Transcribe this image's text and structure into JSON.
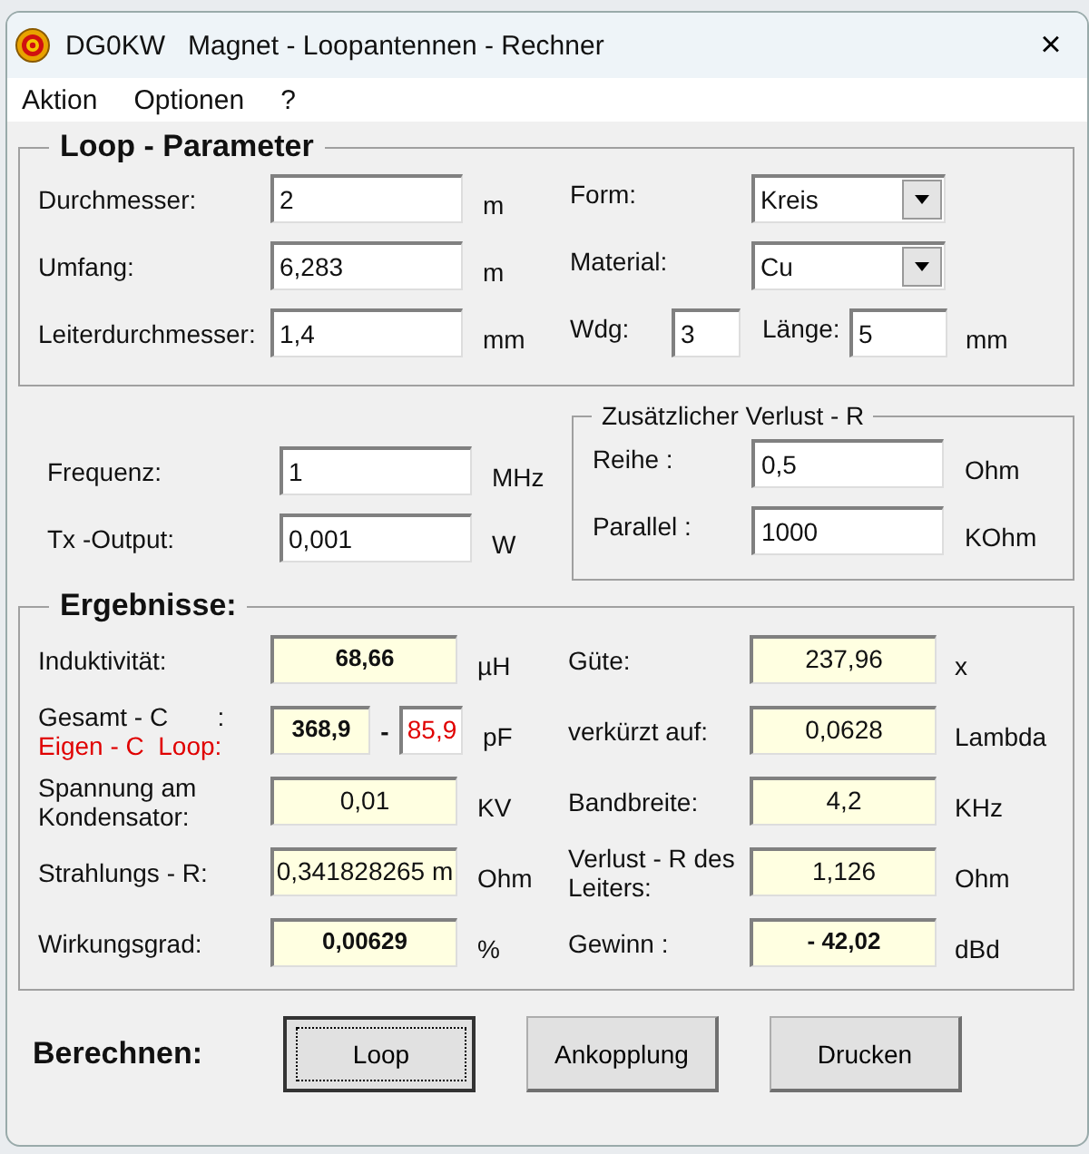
{
  "window": {
    "title": "DG0KW   Magnet - Loopantennen - Rechner",
    "close": "×"
  },
  "menu": [
    {
      "label": "Aktion"
    },
    {
      "label": "Optionen"
    },
    {
      "label": "?"
    }
  ],
  "loop_parameter": {
    "title": "Loop - Parameter",
    "rows": [
      {
        "label": "Durchmesser:",
        "value": "2",
        "unit": "m",
        "right": {
          "kind": "select",
          "label": "Form:",
          "value": "Kreis"
        }
      },
      {
        "label": "Umfang:",
        "value": "6,283",
        "unit": "m",
        "right": {
          "kind": "select",
          "label": "Material:",
          "value": "Cu"
        }
      },
      {
        "label": "Leiterdurchmesser:",
        "value": "1,4",
        "unit": "mm",
        "right": {
          "kind": "pair",
          "label": "Wdg:",
          "value": "3",
          "label_2": "Länge:",
          "value_2": "5",
          "unit": "mm"
        }
      }
    ]
  },
  "signal": [
    {
      "label": "Frequenz:",
      "value": "1",
      "unit": "MHz"
    },
    {
      "label": "Tx -Output:",
      "value": "0,001",
      "unit": "W"
    }
  ],
  "extra_loss": {
    "title": "Zusätzlicher Verlust - R",
    "rows": [
      {
        "label": "Reihe :",
        "value": "0,5",
        "unit": "Ohm"
      },
      {
        "label": "Parallel :",
        "value": "1000",
        "unit": "KOhm"
      }
    ]
  },
  "results": {
    "title": "Ergebnisse:",
    "left": [
      {
        "kind": "single",
        "label": "Induktivität:",
        "value": "68,66",
        "bold": true,
        "unit": "µH"
      },
      {
        "kind": "capacitance",
        "label": "Gesamt - C       :",
        "label_2": "Eigen - C  Loop:",
        "value": "368,9",
        "bold": true,
        "separator": "-",
        "value_2": "85,9",
        "unit": "pF"
      },
      {
        "kind": "single",
        "label": "Spannung am Kondensator:",
        "value": "0,01",
        "bold": false,
        "unit": "KV"
      },
      {
        "kind": "single",
        "label": "Strahlungs - R:",
        "value": "0,341828265 m",
        "bold": false,
        "unit": "Ohm"
      },
      {
        "kind": "single",
        "label": "Wirkungsgrad:",
        "value": "0,00629",
        "bold": true,
        "unit": "%"
      }
    ],
    "right": [
      {
        "label": "Güte:",
        "value": "237,96",
        "bold": false,
        "unit": "x"
      },
      {
        "label": "verkürzt auf:",
        "value": "0,0628",
        "bold": false,
        "unit": "Lambda"
      },
      {
        "label": "Bandbreite:",
        "value": "4,2",
        "bold": false,
        "unit": "KHz"
      },
      {
        "label": "Verlust - R des Leiters:",
        "value": "1,126",
        "bold": false,
        "unit": "Ohm"
      },
      {
        "label": "Gewinn :",
        "value": "- 42,02",
        "bold": true,
        "unit": "dBd"
      }
    ]
  },
  "calculate": {
    "label": "Berechnen:",
    "buttons": [
      {
        "label": "Loop",
        "focused": true
      },
      {
        "label": "Ankopplung",
        "focused": false
      },
      {
        "label": "Drucken",
        "focused": false
      }
    ]
  }
}
